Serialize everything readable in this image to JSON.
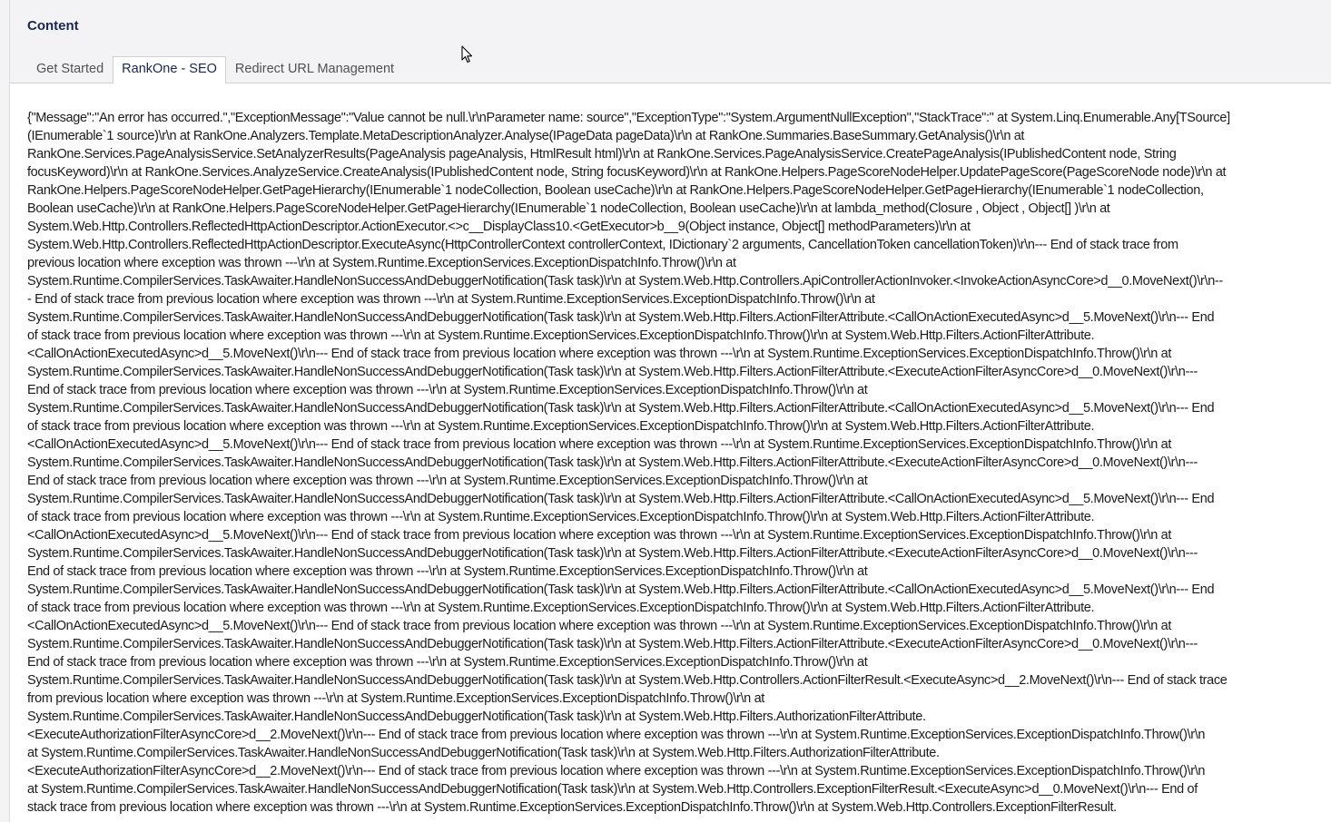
{
  "header": {
    "title": "Content"
  },
  "tabs": [
    {
      "label": "Get Started",
      "active": false
    },
    {
      "label": "RankOne - SEO",
      "active": true
    },
    {
      "label": "Redirect URL Management",
      "active": false
    }
  ],
  "error": {
    "text": "{\"Message\":\"An error has occurred.\",\"ExceptionMessage\":\"Value cannot be null.\\r\\nParameter name: source\",\"ExceptionType\":\"System.ArgumentNullException\",\"StackTrace\":\" at System.Linq.Enumerable.Any[TSource]\n(IEnumerable`1 source)\\r\\n at RankOne.Analyzers.Template.MetaDescriptionAnalyzer.Analyse(IPageData pageData)\\r\\n at RankOne.Summaries.BaseSummary.GetAnalysis()\\r\\n at\nRankOne.Services.PageAnalysisService.SetAnalyzerResults(PageAnalysis pageAnalysis, HtmlResult html)\\r\\n at RankOne.Services.PageAnalysisService.CreatePageAnalysis(IPublishedContent node, String\nfocusKeyword)\\r\\n at RankOne.Services.AnalyzeService.CreateAnalysis(IPublishedContent node, String focusKeyword)\\r\\n at RankOne.Helpers.PageScoreNodeHelper.UpdatePageScore(PageScoreNode node)\\r\\n at\nRankOne.Helpers.PageScoreNodeHelper.GetPageHierarchy(IEnumerable`1 nodeCollection, Boolean useCache)\\r\\n at RankOne.Helpers.PageScoreNodeHelper.GetPageHierarchy(IEnumerable`1 nodeCollection,\nBoolean useCache)\\r\\n at RankOne.Helpers.PageScoreNodeHelper.GetPageHierarchy(IEnumerable`1 nodeCollection, Boolean useCache)\\r\\n at lambda_method(Closure , Object , Object[] )\\r\\n at\nSystem.Web.Http.Controllers.ReflectedHttpActionDescriptor.ActionExecutor.<>c__DisplayClass10.<GetExecutor>b__9(Object instance, Object[] methodParameters)\\r\\n at\nSystem.Web.Http.Controllers.ReflectedHttpActionDescriptor.ExecuteAsync(HttpControllerContext controllerContext, IDictionary`2 arguments, CancellationToken cancellationToken)\\r\\n--- End of stack trace from\nprevious location where exception was thrown ---\\r\\n at System.Runtime.ExceptionServices.ExceptionDispatchInfo.Throw()\\r\\n at\nSystem.Runtime.CompilerServices.TaskAwaiter.HandleNonSuccessAndDebuggerNotification(Task task)\\r\\n at System.Web.Http.Controllers.ApiControllerActionInvoker.<InvokeActionAsyncCore>d__0.MoveNext()\\r\\n--\n- End of stack trace from previous location where exception was thrown ---\\r\\n at System.Runtime.ExceptionServices.ExceptionDispatchInfo.Throw()\\r\\n at\nSystem.Runtime.CompilerServices.TaskAwaiter.HandleNonSuccessAndDebuggerNotification(Task task)\\r\\n at System.Web.Http.Filters.ActionFilterAttribute.<CallOnActionExecutedAsync>d__5.MoveNext()\\r\\n--- End\nof stack trace from previous location where exception was thrown ---\\r\\n at System.Runtime.ExceptionServices.ExceptionDispatchInfo.Throw()\\r\\n at System.Web.Http.Filters.ActionFilterAttribute.\n<CallOnActionExecutedAsync>d__5.MoveNext()\\r\\n--- End of stack trace from previous location where exception was thrown ---\\r\\n at System.Runtime.ExceptionServices.ExceptionDispatchInfo.Throw()\\r\\n at\nSystem.Runtime.CompilerServices.TaskAwaiter.HandleNonSuccessAndDebuggerNotification(Task task)\\r\\n at System.Web.Http.Filters.ActionFilterAttribute.<ExecuteActionFilterAsyncCore>d__0.MoveNext()\\r\\n---\nEnd of stack trace from previous location where exception was thrown ---\\r\\n at System.Runtime.ExceptionServices.ExceptionDispatchInfo.Throw()\\r\\n at\nSystem.Runtime.CompilerServices.TaskAwaiter.HandleNonSuccessAndDebuggerNotification(Task task)\\r\\n at System.Web.Http.Filters.ActionFilterAttribute.<CallOnActionExecutedAsync>d__5.MoveNext()\\r\\n--- End\nof stack trace from previous location where exception was thrown ---\\r\\n at System.Runtime.ExceptionServices.ExceptionDispatchInfo.Throw()\\r\\n at System.Web.Http.Filters.ActionFilterAttribute.\n<CallOnActionExecutedAsync>d__5.MoveNext()\\r\\n--- End of stack trace from previous location where exception was thrown ---\\r\\n at System.Runtime.ExceptionServices.ExceptionDispatchInfo.Throw()\\r\\n at\nSystem.Runtime.CompilerServices.TaskAwaiter.HandleNonSuccessAndDebuggerNotification(Task task)\\r\\n at System.Web.Http.Filters.ActionFilterAttribute.<ExecuteActionFilterAsyncCore>d__0.MoveNext()\\r\\n---\nEnd of stack trace from previous location where exception was thrown ---\\r\\n at System.Runtime.ExceptionServices.ExceptionDispatchInfo.Throw()\\r\\n at\nSystem.Runtime.CompilerServices.TaskAwaiter.HandleNonSuccessAndDebuggerNotification(Task task)\\r\\n at System.Web.Http.Filters.ActionFilterAttribute.<CallOnActionExecutedAsync>d__5.MoveNext()\\r\\n--- End\nof stack trace from previous location where exception was thrown ---\\r\\n at System.Runtime.ExceptionServices.ExceptionDispatchInfo.Throw()\\r\\n at System.Web.Http.Filters.ActionFilterAttribute.\n<CallOnActionExecutedAsync>d__5.MoveNext()\\r\\n--- End of stack trace from previous location where exception was thrown ---\\r\\n at System.Runtime.ExceptionServices.ExceptionDispatchInfo.Throw()\\r\\n at\nSystem.Runtime.CompilerServices.TaskAwaiter.HandleNonSuccessAndDebuggerNotification(Task task)\\r\\n at System.Web.Http.Filters.ActionFilterAttribute.<ExecuteActionFilterAsyncCore>d__0.MoveNext()\\r\\n---\nEnd of stack trace from previous location where exception was thrown ---\\r\\n at System.Runtime.ExceptionServices.ExceptionDispatchInfo.Throw()\\r\\n at\nSystem.Runtime.CompilerServices.TaskAwaiter.HandleNonSuccessAndDebuggerNotification(Task task)\\r\\n at System.Web.Http.Filters.ActionFilterAttribute.<CallOnActionExecutedAsync>d__5.MoveNext()\\r\\n--- End\nof stack trace from previous location where exception was thrown ---\\r\\n at System.Runtime.ExceptionServices.ExceptionDispatchInfo.Throw()\\r\\n at System.Web.Http.Filters.ActionFilterAttribute.\n<CallOnActionExecutedAsync>d__5.MoveNext()\\r\\n--- End of stack trace from previous location where exception was thrown ---\\r\\n at System.Runtime.ExceptionServices.ExceptionDispatchInfo.Throw()\\r\\n at\nSystem.Runtime.CompilerServices.TaskAwaiter.HandleNonSuccessAndDebuggerNotification(Task task)\\r\\n at System.Web.Http.Filters.ActionFilterAttribute.<ExecuteActionFilterAsyncCore>d__0.MoveNext()\\r\\n---\nEnd of stack trace from previous location where exception was thrown ---\\r\\n at System.Runtime.ExceptionServices.ExceptionDispatchInfo.Throw()\\r\\n at\nSystem.Runtime.CompilerServices.TaskAwaiter.HandleNonSuccessAndDebuggerNotification(Task task)\\r\\n at System.Web.Http.Controllers.ActionFilterResult.<ExecuteAsync>d__2.MoveNext()\\r\\n--- End of stack trace\nfrom previous location where exception was thrown ---\\r\\n at System.Runtime.ExceptionServices.ExceptionDispatchInfo.Throw()\\r\\n at\nSystem.Runtime.CompilerServices.TaskAwaiter.HandleNonSuccessAndDebuggerNotification(Task task)\\r\\n at System.Web.Http.Filters.AuthorizationFilterAttribute.\n<ExecuteAuthorizationFilterAsyncCore>d__2.MoveNext()\\r\\n--- End of stack trace from previous location where exception was thrown ---\\r\\n at System.Runtime.ExceptionServices.ExceptionDispatchInfo.Throw()\\r\\n\nat System.Runtime.CompilerServices.TaskAwaiter.HandleNonSuccessAndDebuggerNotification(Task task)\\r\\n at System.Web.Http.Filters.AuthorizationFilterAttribute.\n<ExecuteAuthorizationFilterAsyncCore>d__2.MoveNext()\\r\\n--- End of stack trace from previous location where exception was thrown ---\\r\\n at System.Runtime.ExceptionServices.ExceptionDispatchInfo.Throw()\\r\\n\nat System.Runtime.CompilerServices.TaskAwaiter.HandleNonSuccessAndDebuggerNotification(Task task)\\r\\n at System.Web.Http.Controllers.ExceptionFilterResult.<ExecuteAsync>d__0.MoveNext()\\r\\n--- End of\nstack trace from previous location where exception was thrown ---\\r\\n at System.Runtime.ExceptionServices.ExceptionDispatchInfo.Throw()\\r\\n at System.Web.Http.Controllers.ExceptionFilterResult."
  },
  "colors": {
    "header_bg": "#f3f3f5",
    "title": "#1b264f",
    "tab_text": "#515054",
    "body_text": "#1b1b1b"
  },
  "icons": {
    "cursor": "mouse-pointer-icon"
  }
}
